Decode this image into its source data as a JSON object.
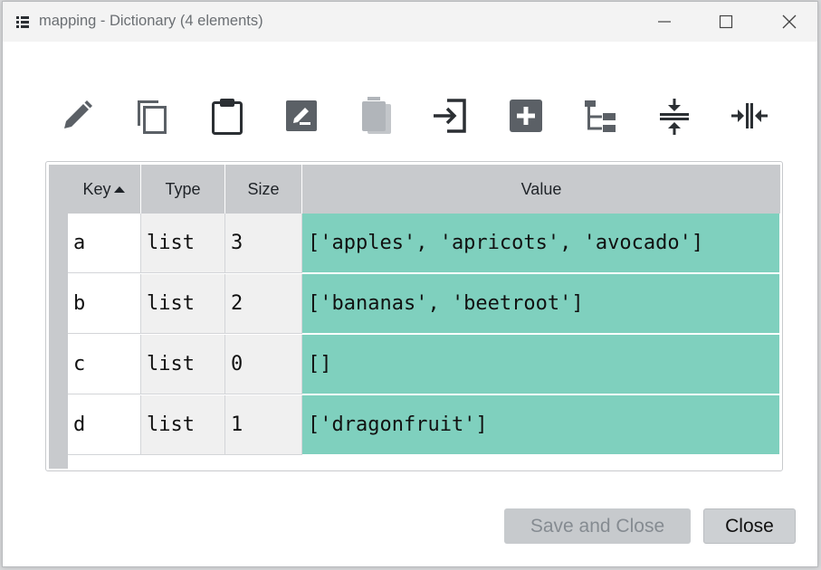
{
  "window": {
    "title": "mapping - Dictionary (4 elements)",
    "icon": "dictionary-icon",
    "controls": [
      "minimize-icon",
      "maximize-icon",
      "close-icon"
    ]
  },
  "toolbar": {
    "icons": [
      "edit-pencil-icon",
      "copy-icon",
      "paste-clipboard-icon",
      "rename-icon",
      "remove-icon",
      "insert-icon",
      "add-icon",
      "hierarchy-icon",
      "collapse-rows-icon",
      "collapse-columns-icon"
    ],
    "enabled": [
      true,
      true,
      true,
      true,
      false,
      true,
      true,
      true,
      true,
      true
    ]
  },
  "table": {
    "headers": {
      "key": "Key",
      "type": "Type",
      "size": "Size",
      "value": "Value"
    },
    "sort": {
      "column": "Key",
      "direction": "ascending"
    },
    "rows": [
      {
        "key": "a",
        "type": "list",
        "size": "3",
        "value": "['apples', 'apricots', 'avocado']"
      },
      {
        "key": "b",
        "type": "list",
        "size": "2",
        "value": "['bananas', 'beetroot']"
      },
      {
        "key": "c",
        "type": "list",
        "size": "0",
        "value": "[]"
      },
      {
        "key": "d",
        "type": "list",
        "size": "1",
        "value": "['dragonfruit']"
      }
    ],
    "value_color": "#7fd0be"
  },
  "buttons": {
    "save_close": "Save and Close",
    "close": "Close"
  }
}
